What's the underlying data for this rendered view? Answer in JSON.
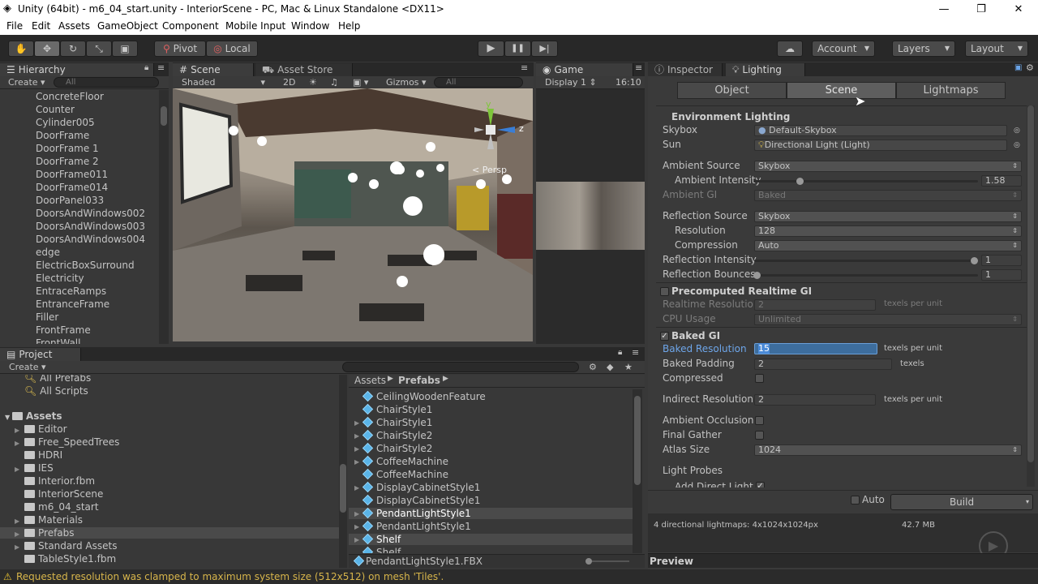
{
  "window": {
    "title": "Unity (64bit) - m6_04_start.unity - InteriorScene - PC, Mac & Linux Standalone <DX11>",
    "controls": {
      "minimize": "—",
      "maximize": "❐",
      "close": "✕"
    }
  },
  "menubar": [
    "File",
    "Edit",
    "Assets",
    "GameObject",
    "Component",
    "Mobile Input",
    "Window",
    "Help"
  ],
  "toolbar": {
    "pivot": "Pivot",
    "local": "Local",
    "account": "Account",
    "layers": "Layers",
    "layout": "Layout",
    "play_icon": "▶",
    "pause_icon": "❚❚",
    "step_icon": "▶|"
  },
  "hierarchy": {
    "tab": "Hierarchy",
    "create": "Create",
    "search_placeholder": "All",
    "items": [
      "ConcreteFloor",
      "Counter",
      "Cylinder005",
      "DoorFrame",
      "DoorFrame 1",
      "DoorFrame 2",
      "DoorFrame011",
      "DoorFrame014",
      "DoorPanel033",
      "DoorsAndWindows002",
      "DoorsAndWindows003",
      "DoorsAndWindows004",
      "edge",
      "ElectricBoxSurround",
      "Electricity",
      "EntraceRamps",
      "EntranceFrame",
      "Filler",
      "FrontFrame",
      "FrontWall"
    ]
  },
  "scene": {
    "tab": "Scene",
    "asset_store_tab": "Asset Store",
    "shaded": "Shaded",
    "mode_2d": "2D",
    "gizmos": "Gizmos",
    "search_placeholder": "All",
    "persp_label": "< Persp",
    "axis_y": "y",
    "axis_z": "z"
  },
  "game": {
    "tab": "Game",
    "display": "Display 1",
    "aspect": "16:10"
  },
  "project": {
    "tab": "Project",
    "create": "Create",
    "favorites": [
      "All Prefabs",
      "All Scripts"
    ],
    "tree_root": "Assets",
    "tree": [
      "Editor",
      "Free_SpeedTrees",
      "HDRI",
      "IES",
      "Interior.fbm",
      "InteriorScene",
      "m6_04_start",
      "Materials",
      "Prefabs",
      "Standard Assets",
      "TableStyle1.fbm"
    ],
    "breadcrumb_root": "Assets",
    "breadcrumb_current": "Prefabs",
    "files": [
      "CeilingWoodenFeature",
      "ChairStyle1",
      "ChairStyle1",
      "ChairStyle2",
      "ChairStyle2",
      "CoffeeMachine",
      "CoffeeMachine",
      "DisplayCabinetStyle1",
      "DisplayCabinetStyle1",
      "PendantLightStyle1",
      "PendantLightStyle1",
      "Shelf",
      "Shelf"
    ],
    "selected_file": "PendantLightStyle1.FBX"
  },
  "inspector": {
    "tab_inspector": "Inspector",
    "tab_lighting": "Lighting",
    "seg_object": "Object",
    "seg_scene": "Scene",
    "seg_lightmaps": "Lightmaps",
    "env_header": "Environment Lighting",
    "skybox_label": "Skybox",
    "skybox_value": "Default-Skybox",
    "sun_label": "Sun",
    "sun_value": "Directional Light (Light)",
    "ambient_source_label": "Ambient Source",
    "ambient_source_value": "Skybox",
    "ambient_intensity_label": "Ambient Intensity",
    "ambient_intensity_value": "1.58",
    "ambient_gi_label": "Ambient GI",
    "ambient_gi_value": "Baked",
    "reflection_source_label": "Reflection Source",
    "reflection_source_value": "Skybox",
    "resolution_label": "Resolution",
    "resolution_value": "128",
    "compression_label": "Compression",
    "compression_value": "Auto",
    "reflection_intensity_label": "Reflection Intensity",
    "reflection_intensity_value": "1",
    "reflection_bounces_label": "Reflection Bounces",
    "reflection_bounces_value": "1",
    "precomputed_header": "Precomputed Realtime GI",
    "realtime_res_label": "Realtime Resolution",
    "realtime_res_value": "2",
    "realtime_res_unit": "texels per unit",
    "cpu_usage_label": "CPU Usage",
    "cpu_usage_value": "Unlimited",
    "baked_header": "Baked GI",
    "baked_res_label": "Baked Resolution",
    "baked_res_value": "15",
    "baked_res_unit": "texels per unit",
    "baked_padding_label": "Baked Padding",
    "baked_padding_value": "2",
    "baked_padding_unit": "texels",
    "compressed_label": "Compressed",
    "indirect_res_label": "Indirect Resolution",
    "indirect_res_value": "2",
    "indirect_res_unit": "texels per unit",
    "ambient_occlusion_label": "Ambient Occlusion",
    "final_gather_label": "Final Gather",
    "atlas_size_label": "Atlas Size",
    "atlas_size_value": "1024",
    "light_probes_label": "Light Probes",
    "add_direct_light_label": "Add Direct Light",
    "auto_label": "Auto",
    "build_label": "Build",
    "lightmap_summary": "4 directional lightmaps: 4x1024x1024px",
    "lightmap_size": "42.7 MB",
    "preview_label": "Preview"
  },
  "status": {
    "message": "Requested resolution was clamped to maximum system size (512x512) on mesh 'Tiles'.",
    "color": "#d7b54b"
  }
}
